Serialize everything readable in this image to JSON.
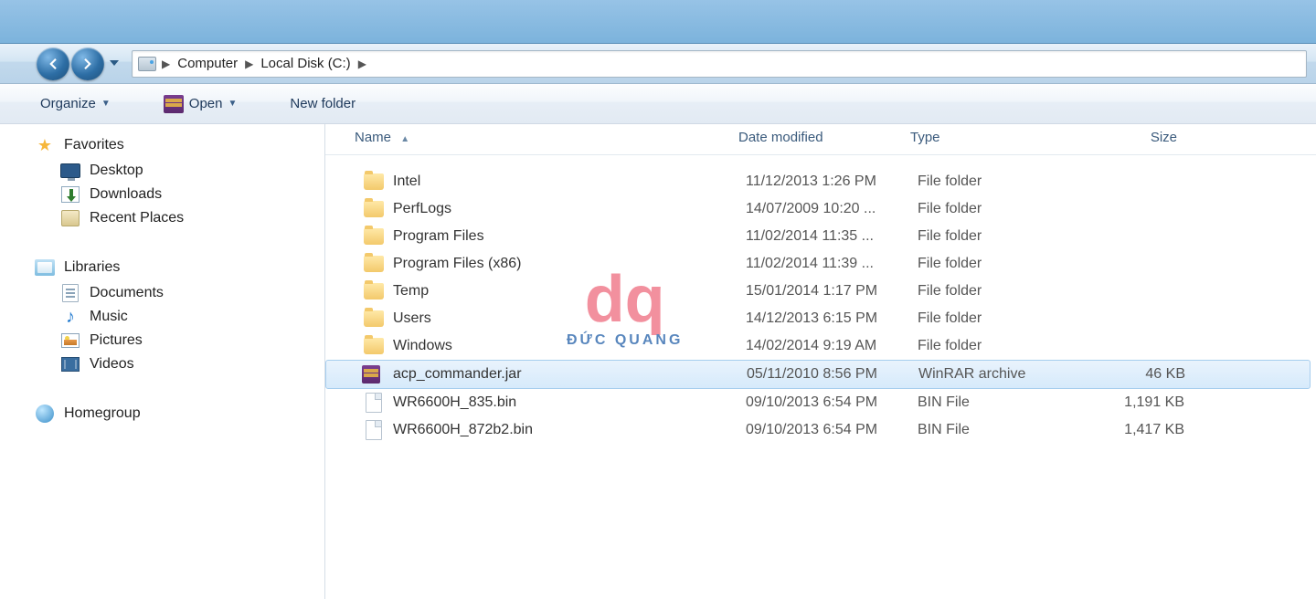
{
  "breadcrumb": {
    "items": [
      "Computer",
      "Local Disk (C:)"
    ]
  },
  "toolbar": {
    "organize": "Organize",
    "open": "Open",
    "new_folder": "New folder"
  },
  "sidebar": {
    "favorites": {
      "label": "Favorites",
      "items": [
        {
          "label": "Desktop",
          "icon": "desktop"
        },
        {
          "label": "Downloads",
          "icon": "downloads"
        },
        {
          "label": "Recent Places",
          "icon": "recent"
        }
      ]
    },
    "libraries": {
      "label": "Libraries",
      "items": [
        {
          "label": "Documents",
          "icon": "doc"
        },
        {
          "label": "Music",
          "icon": "music"
        },
        {
          "label": "Pictures",
          "icon": "pic"
        },
        {
          "label": "Videos",
          "icon": "vid"
        }
      ]
    },
    "homegroup": {
      "label": "Homegroup"
    }
  },
  "columns": {
    "name": "Name",
    "date": "Date modified",
    "type": "Type",
    "size": "Size"
  },
  "files": [
    {
      "name": "Intel",
      "date": "11/12/2013 1:26 PM",
      "type": "File folder",
      "size": "",
      "icon": "folder",
      "selected": false
    },
    {
      "name": "PerfLogs",
      "date": "14/07/2009 10:20 ...",
      "type": "File folder",
      "size": "",
      "icon": "folder",
      "selected": false
    },
    {
      "name": "Program Files",
      "date": "11/02/2014 11:35 ...",
      "type": "File folder",
      "size": "",
      "icon": "folder",
      "selected": false
    },
    {
      "name": "Program Files (x86)",
      "date": "11/02/2014 11:39 ...",
      "type": "File folder",
      "size": "",
      "icon": "folder",
      "selected": false
    },
    {
      "name": "Temp",
      "date": "15/01/2014 1:17 PM",
      "type": "File folder",
      "size": "",
      "icon": "folder",
      "selected": false
    },
    {
      "name": "Users",
      "date": "14/12/2013 6:15 PM",
      "type": "File folder",
      "size": "",
      "icon": "folder",
      "selected": false
    },
    {
      "name": "Windows",
      "date": "14/02/2014 9:19 AM",
      "type": "File folder",
      "size": "",
      "icon": "folder",
      "selected": false
    },
    {
      "name": "acp_commander.jar",
      "date": "05/11/2010 8:56 PM",
      "type": "WinRAR archive",
      "size": "46 KB",
      "icon": "winrar",
      "selected": true
    },
    {
      "name": "WR6600H_835.bin",
      "date": "09/10/2013 6:54 PM",
      "type": "BIN File",
      "size": "1,191 KB",
      "icon": "file",
      "selected": false
    },
    {
      "name": "WR6600H_872b2.bin",
      "date": "09/10/2013 6:54 PM",
      "type": "BIN File",
      "size": "1,417 KB",
      "icon": "file",
      "selected": false
    }
  ],
  "watermark": {
    "text": "ĐỨC QUANG"
  }
}
